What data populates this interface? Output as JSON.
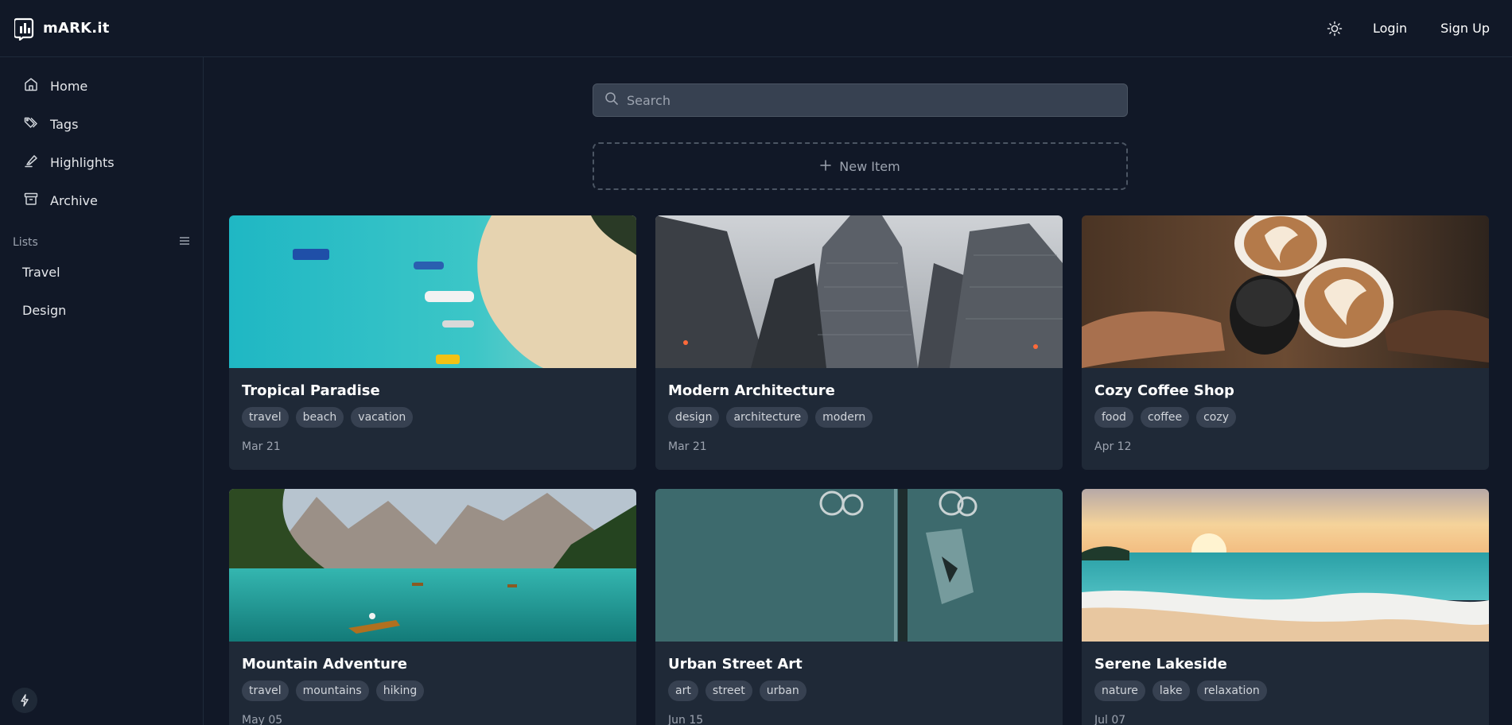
{
  "brand": {
    "name": "mARK.it"
  },
  "header": {
    "login_label": "Login",
    "signup_label": "Sign Up"
  },
  "sidebar": {
    "nav": [
      {
        "label": "Home",
        "icon": "home-icon"
      },
      {
        "label": "Tags",
        "icon": "tags-icon"
      },
      {
        "label": "Highlights",
        "icon": "highlighter-icon"
      },
      {
        "label": "Archive",
        "icon": "archive-icon"
      }
    ],
    "lists_title": "Lists",
    "lists": [
      {
        "label": "Travel"
      },
      {
        "label": "Design"
      }
    ]
  },
  "search": {
    "placeholder": "Search"
  },
  "new_item": {
    "label": "New Item"
  },
  "cards": [
    {
      "title": "Tropical Paradise",
      "tags": [
        "travel",
        "beach",
        "vacation"
      ],
      "date": "Mar 21"
    },
    {
      "title": "Modern Architecture",
      "tags": [
        "design",
        "architecture",
        "modern"
      ],
      "date": "Mar 21"
    },
    {
      "title": "Cozy Coffee Shop",
      "tags": [
        "food",
        "coffee",
        "cozy"
      ],
      "date": "Apr 12"
    },
    {
      "title": "Mountain Adventure",
      "tags": [
        "travel",
        "mountains",
        "hiking"
      ],
      "date": "May 05"
    },
    {
      "title": "Urban Street Art",
      "tags": [
        "art",
        "street",
        "urban"
      ],
      "date": "Jun 15"
    },
    {
      "title": "Serene Lakeside",
      "tags": [
        "nature",
        "lake",
        "relaxation"
      ],
      "date": "Jul 07"
    }
  ],
  "colors": {
    "background": "#111827",
    "card": "#1f2937",
    "tag": "#374151"
  }
}
